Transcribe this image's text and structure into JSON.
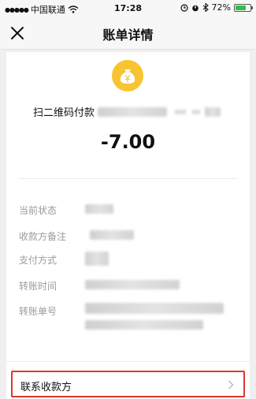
{
  "status_bar": {
    "carrier": "中国联通",
    "time": "17:28",
    "battery_percent": "72%",
    "battery_level": 0.72
  },
  "nav": {
    "title": "账单详情"
  },
  "bill": {
    "payee_prefix": "扫二维码付款",
    "amount": "-7.00"
  },
  "details": [
    {
      "label": "当前状态"
    },
    {
      "label": "收款方备注"
    },
    {
      "label": "支付方式"
    },
    {
      "label": "转账时间"
    },
    {
      "label": "转账单号"
    }
  ],
  "contact": {
    "label": "联系收款方"
  },
  "colors": {
    "accent_gold": "#f6c531",
    "highlight_red": "#e0352b",
    "battery_green": "#2fbf4a"
  }
}
